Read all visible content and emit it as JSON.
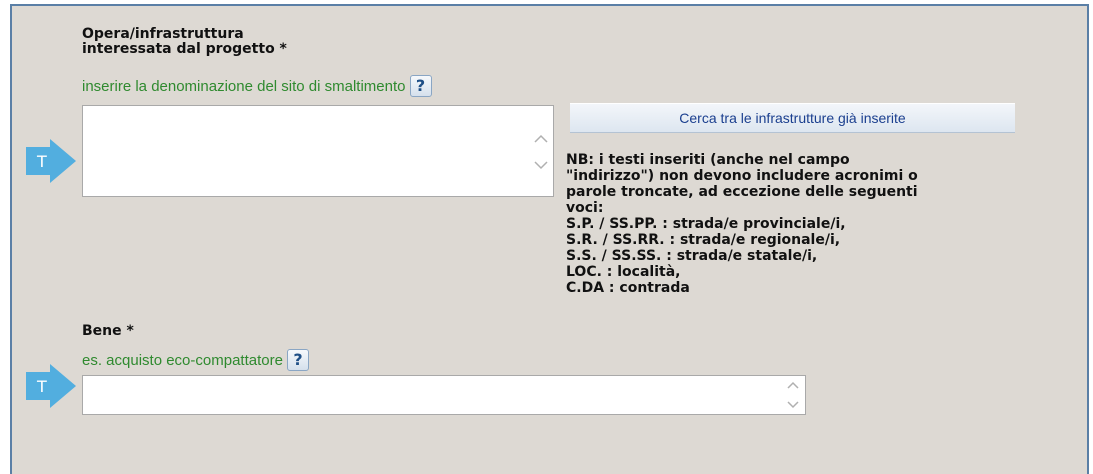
{
  "opera": {
    "title_line1": "Opera/infrastruttura",
    "title_line2": "interessata dal progetto *",
    "hint": "inserire la denominazione del sito di smaltimento",
    "help_symbol": "?",
    "marker_letter": "T",
    "value": ""
  },
  "search_button": {
    "label": "Cerca tra le infrastrutture già inserite"
  },
  "nb_lines": [
    "NB: i testi inseriti (anche nel campo",
    "\"indirizzo\") non devono includere acronimi o",
    "parole troncate, ad eccezione delle seguenti",
    "voci:",
    "S.P. / SS.PP. : strada/e provinciale/i,",
    "S.R. / SS.RR. : strada/e regionale/i,",
    "S.S. / SS.SS. : strada/e statale/i,",
    "LOC. : località,",
    "C.DA : contrada"
  ],
  "bene": {
    "title": "Bene *",
    "hint": "es. acquisto eco-compattatore",
    "help_symbol": "?",
    "marker_letter": "T",
    "value": ""
  },
  "colors": {
    "panel_bg": "#ddd9d3",
    "hint_green": "#2f8a2f",
    "marker_blue": "#52aedf",
    "border_blue": "#5a7fa6"
  }
}
